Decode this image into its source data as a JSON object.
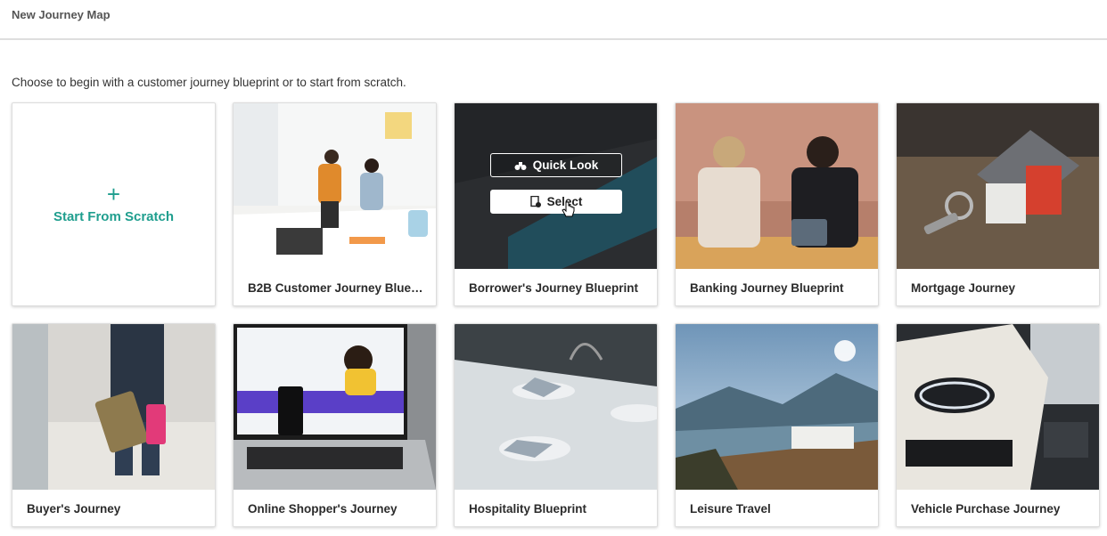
{
  "header": {
    "title": "New Journey Map"
  },
  "instructions": "Choose to begin with a customer journey blueprint or to start from scratch.",
  "scratch": {
    "plus": "+",
    "label": "Start From Scratch"
  },
  "overlay": {
    "quick_look": "Quick Look",
    "select": "Select"
  },
  "cards": [
    {
      "label": "B2B Customer Journey Bluepr..."
    },
    {
      "label": "Borrower's Journey Blueprint"
    },
    {
      "label": "Banking Journey Blueprint"
    },
    {
      "label": "Mortgage Journey"
    },
    {
      "label": "Buyer's Journey"
    },
    {
      "label": "Online Shopper's Journey"
    },
    {
      "label": "Hospitality Blueprint"
    },
    {
      "label": "Leisure Travel"
    },
    {
      "label": "Vehicle Purchase Journey"
    }
  ],
  "colors": {
    "accent": "#1f9e8e",
    "divider": "#dedede"
  }
}
